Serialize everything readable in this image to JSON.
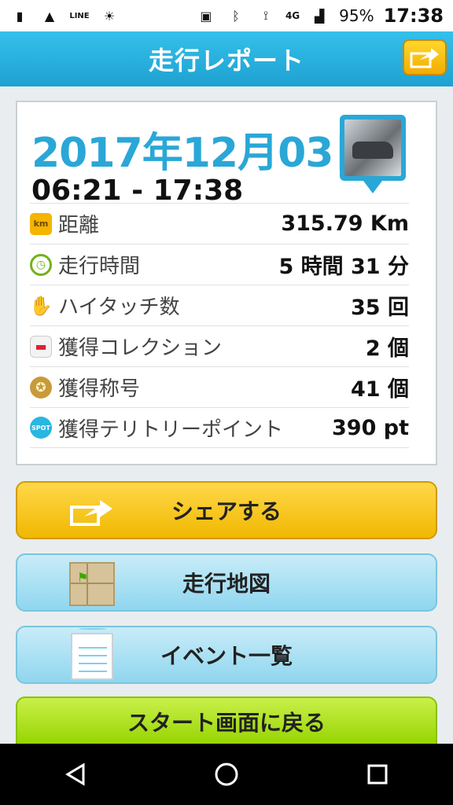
{
  "statusbar": {
    "left_icons": [
      "au-icon",
      "image-icon",
      "line-icon",
      "weather-icon"
    ],
    "line_label": "LINE",
    "network_label": "4G",
    "battery": "95%",
    "time": "17:38"
  },
  "header": {
    "title": "走行レポート",
    "share_icon": "share-icon"
  },
  "report": {
    "date": "2017年12月03日",
    "time_range": "06:21 - 17:38",
    "rows": [
      {
        "icon": "km-icon",
        "icon_text": "km",
        "label": "距離",
        "value": "315.79 Km"
      },
      {
        "icon": "clock-icon",
        "label": "走行時間",
        "value": "5 時間 31 分"
      },
      {
        "icon": "hi-touch-icon",
        "label": "ハイタッチ数",
        "value": "35 回"
      },
      {
        "icon": "car-icon",
        "label": "獲得コレクション",
        "value": "2 個"
      },
      {
        "icon": "medal-icon",
        "label": "獲得称号",
        "value": "41 個"
      },
      {
        "icon": "spot-icon",
        "icon_text": "SPOT",
        "label": "獲得テリトリーポイント",
        "value": "390 pt"
      }
    ]
  },
  "buttons": {
    "share": "シェアする",
    "map": "走行地図",
    "events": "イベント一覧",
    "start": "スタート画面に戻る"
  },
  "colors": {
    "header": "#1ea1d2",
    "date": "#2aa7d6",
    "share_button": "#f0b800",
    "map_button": "#8fd6ef",
    "start_button": "#96d400"
  }
}
